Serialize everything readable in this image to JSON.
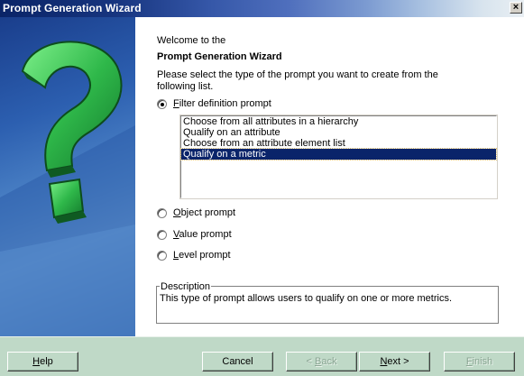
{
  "window": {
    "title": "Prompt Generation Wizard",
    "close_glyph": "×"
  },
  "content": {
    "welcome": "Welcome to the",
    "heading": "Prompt Generation Wizard",
    "instructions": "Please select the type of the prompt you want to create from the following list."
  },
  "prompt_types": {
    "filter": {
      "first": "F",
      "rest": "ilter definition prompt",
      "checked": true
    },
    "object": {
      "first": "O",
      "rest": "bject prompt",
      "checked": false
    },
    "value": {
      "first": "V",
      "rest": "alue prompt",
      "checked": false
    },
    "level": {
      "first": "L",
      "rest": "evel prompt",
      "checked": false
    }
  },
  "filter_list": {
    "items": [
      "Choose from all attributes in a hierarchy",
      "Qualify on an attribute",
      "Choose from an attribute element list",
      "Qualify on a metric"
    ],
    "selected_index": 3
  },
  "description": {
    "label": "Description",
    "text": "This type of prompt allows users to qualify on one or more metrics."
  },
  "buttons": {
    "help": {
      "first": "H",
      "rest": "elp"
    },
    "cancel": "Cancel",
    "back": {
      "prefix": "< ",
      "first": "B",
      "rest": "ack",
      "disabled": true
    },
    "next": {
      "first": "N",
      "rest": "ext >"
    },
    "finish": {
      "first": "F",
      "rest": "inish",
      "disabled": true
    }
  },
  "colors": {
    "selection": "#0a246a",
    "button_bar": "#bfd9c7",
    "question_mark": "#2fb84a"
  },
  "icons": {
    "art": "question-mark-graphic"
  }
}
